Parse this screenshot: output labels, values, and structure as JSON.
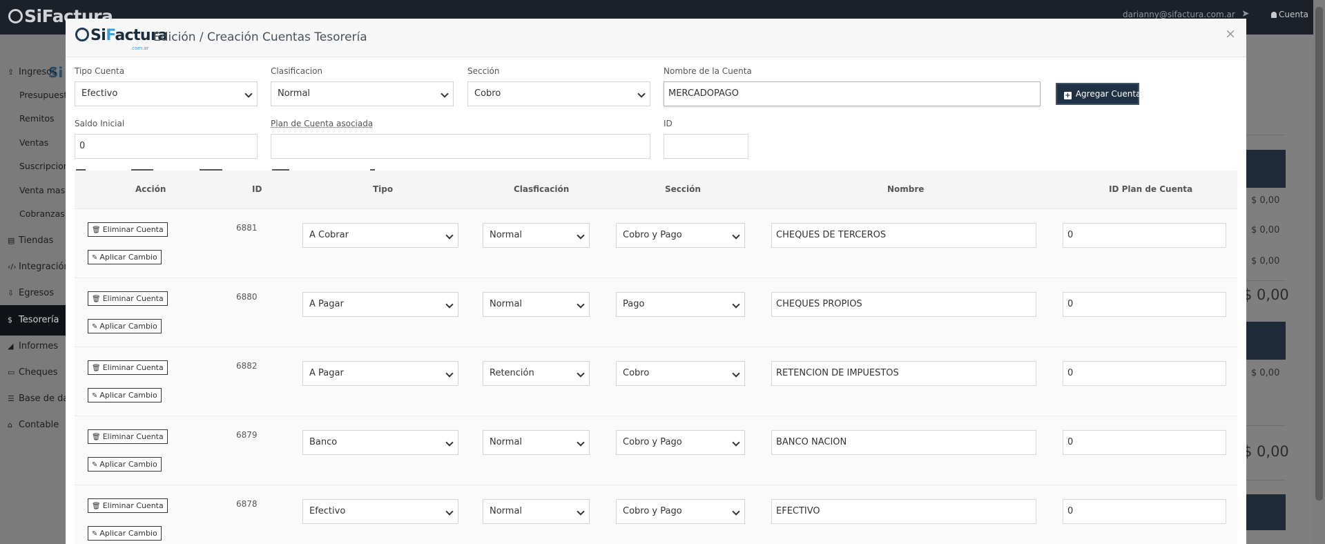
{
  "app": {
    "brand": "SiFactura",
    "user_email": "darianny@sifactura.com.ar",
    "account_label": "Cuenta"
  },
  "sidebar": {
    "items": [
      {
        "label": "Ingresos",
        "icon": "upload-icon",
        "sub": false
      },
      {
        "label": "Presupuestos",
        "sub": true
      },
      {
        "label": "Remitos",
        "sub": true
      },
      {
        "label": "Ventas",
        "sub": true
      },
      {
        "label": "Suscripciones",
        "sub": true
      },
      {
        "label": "Venta masiva",
        "sub": true
      },
      {
        "label": "Cobranzas",
        "sub": true
      },
      {
        "label": "Tiendas",
        "icon": "shopping-bag-icon",
        "sub": false
      },
      {
        "label": "Integración",
        "icon": "code-icon",
        "sub": false
      },
      {
        "label": "Egresos",
        "icon": "download-icon",
        "sub": false
      },
      {
        "label": "Tesorería",
        "icon": "dollar-icon",
        "sub": false,
        "active": true
      },
      {
        "label": "Informes",
        "icon": "chart-icon",
        "sub": false
      },
      {
        "label": "Cheques",
        "icon": "card-icon",
        "sub": false
      },
      {
        "label": "Base de datos",
        "icon": "database-icon",
        "sub": false
      },
      {
        "label": "Contable",
        "icon": "bank-icon",
        "sub": false
      }
    ]
  },
  "background": {
    "amounts": [
      "$ 0,00",
      "$ 0,00",
      "$ 0,00",
      "$ 0,00",
      "$ 0,00",
      "$ 0,00"
    ]
  },
  "modal": {
    "logo_main": "SiFactura",
    "logo_sub": ".com.ar",
    "title": "Edición / Creación Cuentas Tesorería",
    "close": "×",
    "form": {
      "tipo_label": "Tipo Cuenta",
      "tipo_value": "Efectivo",
      "clasificacion_label": "Clasificacion",
      "clasificacion_value": "Normal",
      "seccion_label": "Sección",
      "seccion_value": "Cobro",
      "nombre_label": "Nombre de la Cuenta",
      "nombre_value": "MERCADOPAGO",
      "add_button": "Agregar Cuenta",
      "saldo_label": "Saldo Inicial",
      "saldo_value": "0",
      "plan_label": "Plan de Cuenta asociada",
      "plan_value": "",
      "id_label": "ID",
      "id_value": ""
    },
    "table": {
      "headers": [
        "Acción",
        "ID",
        "Tipo",
        "Clasficación",
        "Sección",
        "Nombre",
        "ID Plan de Cuenta"
      ],
      "delete_label": "Eliminar Cuenta",
      "apply_label": "Aplicar Cambio",
      "rows": [
        {
          "id": "6881",
          "tipo": "A Cobrar",
          "clasificacion": "Normal",
          "seccion": "Cobro y Pago",
          "nombre": "CHEQUES DE TERCEROS",
          "plan": "0"
        },
        {
          "id": "6880",
          "tipo": "A Pagar",
          "clasificacion": "Normal",
          "seccion": "Pago",
          "nombre": "CHEQUES PROPIOS",
          "plan": "0"
        },
        {
          "id": "6882",
          "tipo": "A Pagar",
          "clasificacion": "Retención",
          "seccion": "Cobro",
          "nombre": "RETENCION DE IMPUESTOS",
          "plan": "0"
        },
        {
          "id": "6879",
          "tipo": "Banco",
          "clasificacion": "Normal",
          "seccion": "Cobro y Pago",
          "nombre": "BANCO NACION",
          "plan": "0"
        },
        {
          "id": "6878",
          "tipo": "Efectivo",
          "clasificacion": "Normal",
          "seccion": "Cobro y Pago",
          "nombre": "EFECTIVO",
          "plan": "0"
        }
      ]
    }
  }
}
